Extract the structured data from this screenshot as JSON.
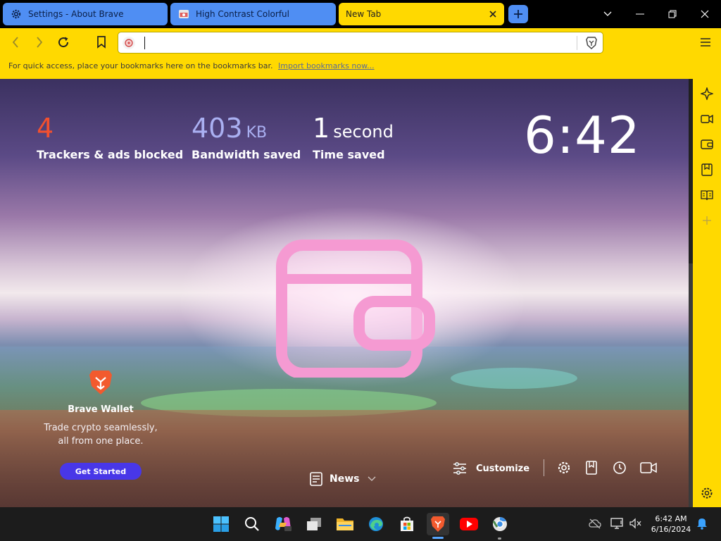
{
  "tabs": [
    {
      "title": "Settings - About Brave",
      "icon": "gear-icon",
      "state": "inactive"
    },
    {
      "title": "High Contrast Colorful",
      "icon": "page-icon",
      "state": "inactive"
    },
    {
      "title": "New Tab",
      "icon": "none",
      "state": "active"
    }
  ],
  "colors": {
    "accent_yellow": "#ffd900",
    "tab_inactive_blue": "#4f8ef3",
    "trackers_red": "#f2502f",
    "bandwidth_lavender": "#aab0f2",
    "wallet_button": "#4837e8"
  },
  "omnibox": {
    "value": "",
    "placeholder": ""
  },
  "bookmarks_bar": {
    "message": "For quick access, place your bookmarks here on the bookmarks bar.",
    "link": "Import bookmarks now..."
  },
  "stats": {
    "trackers": {
      "value": "4",
      "label": "Trackers & ads blocked"
    },
    "bandwidth": {
      "value": "403",
      "unit": "KB",
      "label": "Bandwidth saved"
    },
    "time": {
      "value": "1",
      "unit": "second",
      "label": "Time saved"
    }
  },
  "clock": "6:42",
  "wallet": {
    "title": "Brave Wallet",
    "line1": "Trade crypto seamlessly,",
    "line2": "all from one place.",
    "button": "Get Started"
  },
  "news_label": "News",
  "customize_label": "Customize",
  "taskbar": {
    "time": "6:42 AM",
    "date": "6/16/2024",
    "apps": [
      "start-icon",
      "search-icon",
      "copilot-icon",
      "task-view-icon",
      "file-explorer-icon",
      "edge-icon",
      "store-icon",
      "brave-icon",
      "youtube-icon",
      "chrome-icon"
    ]
  }
}
